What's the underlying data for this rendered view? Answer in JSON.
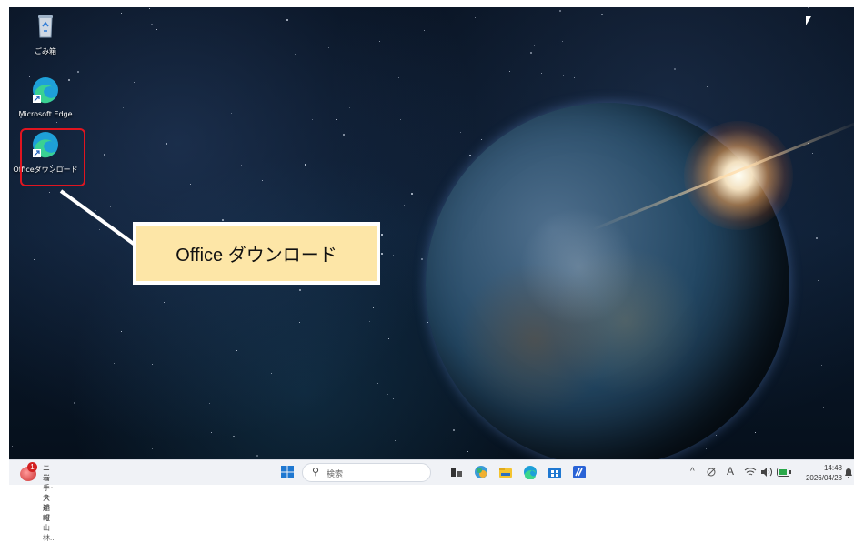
{
  "desktop": {
    "icons": [
      {
        "label": "ごみ箱",
        "icon": "recycle-bin-icon"
      },
      {
        "label": "Microsoft Edge",
        "icon": "edge-icon"
      },
      {
        "label": "Officeダウンロード",
        "icon": "edge-icon"
      }
    ],
    "callout": {
      "text": "Office ダウンロード"
    }
  },
  "taskbar": {
    "news": {
      "badge": "1",
      "title": "ニュース速報",
      "subtitle": "岩手･大船町山林..."
    },
    "search": {
      "placeholder": "検索"
    },
    "apps": [
      "start-icon",
      "task-view-icon",
      "copilot-icon",
      "file-explorer-icon",
      "edge-icon",
      "store-icon",
      "app-icon"
    ],
    "tray": {
      "chevron": "^",
      "ime": "A"
    },
    "clock": {
      "time": "14:48",
      "date": "2026/04/28"
    }
  },
  "colors": {
    "highlight": "#e01520",
    "callout_bg": "#fde6a7",
    "taskbar_bg": "#f0f2f6"
  }
}
